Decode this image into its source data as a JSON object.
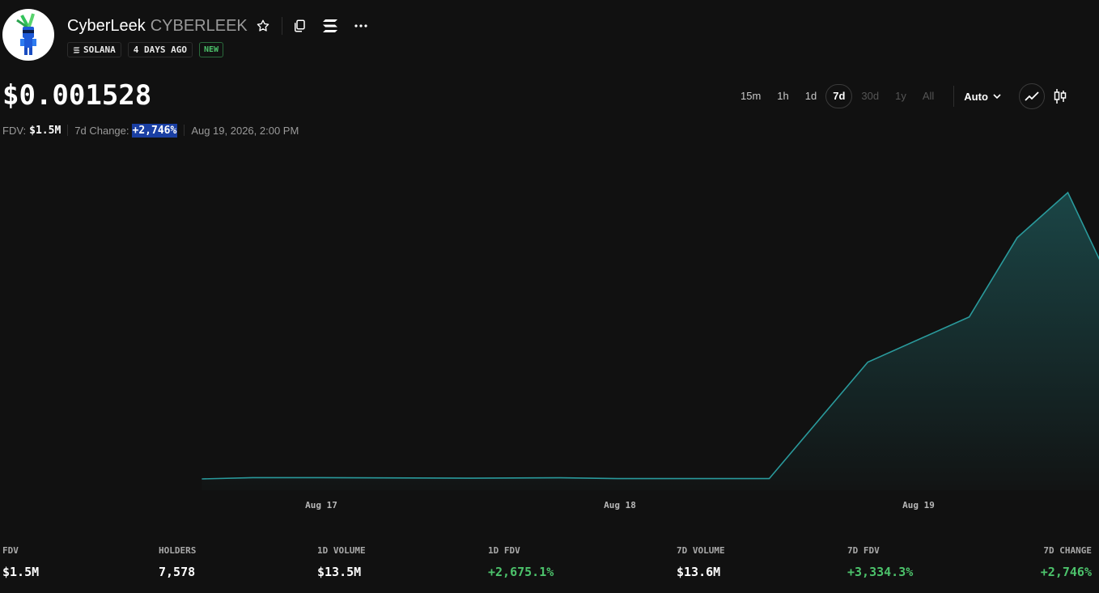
{
  "token": {
    "name": "CyberLeek",
    "symbol": "CYBERLEEK",
    "avatar_icon": "cyber-leek-mascot",
    "tags": {
      "chain": "SOLANA",
      "age": "4 DAYS AGO",
      "status": "NEW"
    }
  },
  "header_actions": {
    "favorite_icon": "star-outline-icon",
    "copy_icon": "copy-icon",
    "chain_icon": "solana-icon",
    "more_icon": "more-horizontal-icon"
  },
  "price": {
    "value": "$0.001528",
    "fdv_label": "FDV:",
    "fdv_value": "$1.5M",
    "change_label": "7d Change:",
    "change_value": "+2,746%",
    "timestamp": "Aug 19, 2026, 2:00 PM"
  },
  "ranges": [
    {
      "label": "15m",
      "state": "normal"
    },
    {
      "label": "1h",
      "state": "normal"
    },
    {
      "label": "1d",
      "state": "normal"
    },
    {
      "label": "7d",
      "state": "active"
    },
    {
      "label": "30d",
      "state": "disabled"
    },
    {
      "label": "1y",
      "state": "disabled"
    },
    {
      "label": "All",
      "state": "disabled"
    }
  ],
  "scale_select": "Auto",
  "chart_data": {
    "type": "area",
    "x_ticks": [
      "Aug 17",
      "Aug 18",
      "Aug 19"
    ],
    "x": [
      16.6,
      16.77,
      17.0,
      17.5,
      17.8,
      18.0,
      18.3,
      18.5,
      18.83,
      19.17,
      19.33,
      19.5,
      19.67
    ],
    "values": [
      6e-05,
      6.7e-05,
      6.7e-05,
      6.4e-05,
      6.6e-05,
      6.2e-05,
      6.2e-05,
      6.2e-05,
      0.00068,
      0.00092,
      0.00134,
      0.00158,
      0.00101
    ],
    "ylim": [
      0,
      0.0017
    ],
    "grid": false,
    "legend": "none",
    "color": "#2a9a9c"
  },
  "stats": [
    {
      "label": "FDV",
      "value": "$1.5M",
      "positive": false
    },
    {
      "label": "HOLDERS",
      "value": "7,578",
      "positive": false
    },
    {
      "label": "1D VOLUME",
      "value": "$13.5M",
      "positive": false
    },
    {
      "label": "1D FDV",
      "value": "+2,675.1%",
      "positive": true
    },
    {
      "label": "7D VOLUME",
      "value": "$13.6M",
      "positive": false
    },
    {
      "label": "7D FDV",
      "value": "+3,334.3%",
      "positive": true
    },
    {
      "label": "7D CHANGE",
      "value": "+2,746%",
      "positive": true
    }
  ]
}
